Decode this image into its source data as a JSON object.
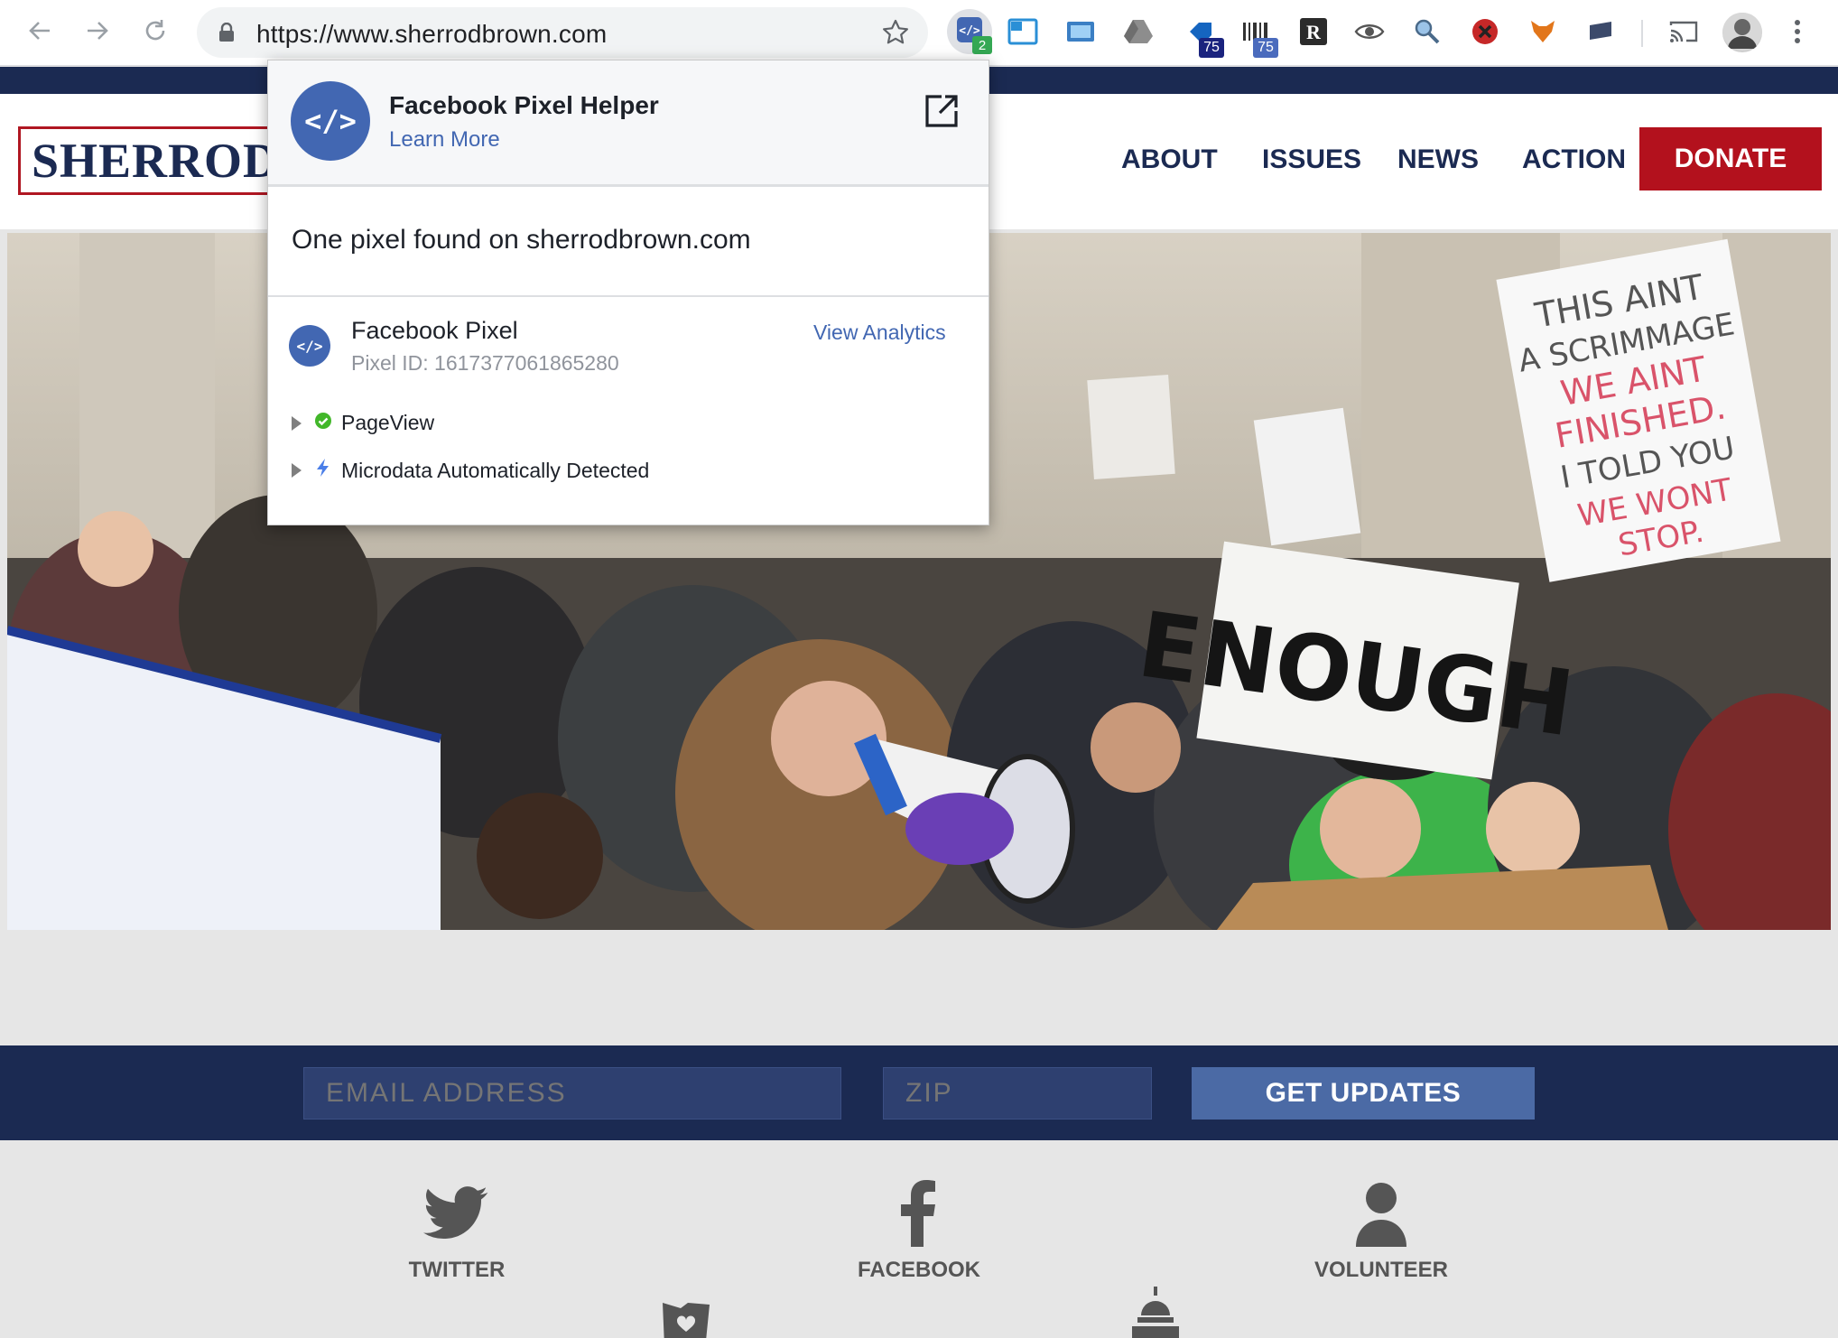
{
  "browser": {
    "url": "https://www.sherrodbrown.com",
    "extensions": [
      {
        "name": "pixel-helper-icon",
        "badge": "2"
      },
      {
        "name": "window-icon",
        "badge": ""
      },
      {
        "name": "screenshot-icon",
        "badge": ""
      },
      {
        "name": "drive-icon",
        "badge": ""
      },
      {
        "name": "tag-icon",
        "badge": "75"
      },
      {
        "name": "barcode-icon",
        "badge": "75"
      },
      {
        "name": "readability-icon",
        "badge": ""
      },
      {
        "name": "eye-icon",
        "badge": ""
      },
      {
        "name": "magnifier-icon",
        "badge": ""
      },
      {
        "name": "blocker-icon",
        "badge": ""
      },
      {
        "name": "fox-icon",
        "badge": ""
      },
      {
        "name": "flag-icon",
        "badge": ""
      }
    ]
  },
  "site": {
    "logo": "SHERROD",
    "nav": [
      "ABOUT",
      "ISSUES",
      "NEWS",
      "ACTION"
    ],
    "donate": "DONATE",
    "signup": {
      "email_placeholder": "EMAIL ADDRESS",
      "zip_placeholder": "ZIP",
      "button": "GET UPDATES"
    },
    "social": [
      "TWITTER",
      "FACEBOOK",
      "VOLUNTEER"
    ],
    "hero_sign_text": "ENOUGH",
    "hero_sign2": [
      "THIS AINT",
      "A SCRIMMAGE",
      "WE AINT",
      "FINISHED.",
      "I TOLD YOU",
      "WE WONT",
      "STOP."
    ]
  },
  "popup": {
    "title": "Facebook Pixel Helper",
    "learn_more": "Learn More",
    "summary": "One pixel found on sherrodbrown.com",
    "pixel_name": "Facebook Pixel",
    "pixel_id": "Pixel ID: 1617377061865280",
    "view_analytics": "View Analytics",
    "events": [
      {
        "label": "PageView",
        "status": "success"
      },
      {
        "label": "Microdata Automatically Detected",
        "status": "info"
      }
    ]
  },
  "colors": {
    "brand_navy": "#1b2a52",
    "brand_red": "#b3111d",
    "fb_blue": "#4267b2"
  }
}
